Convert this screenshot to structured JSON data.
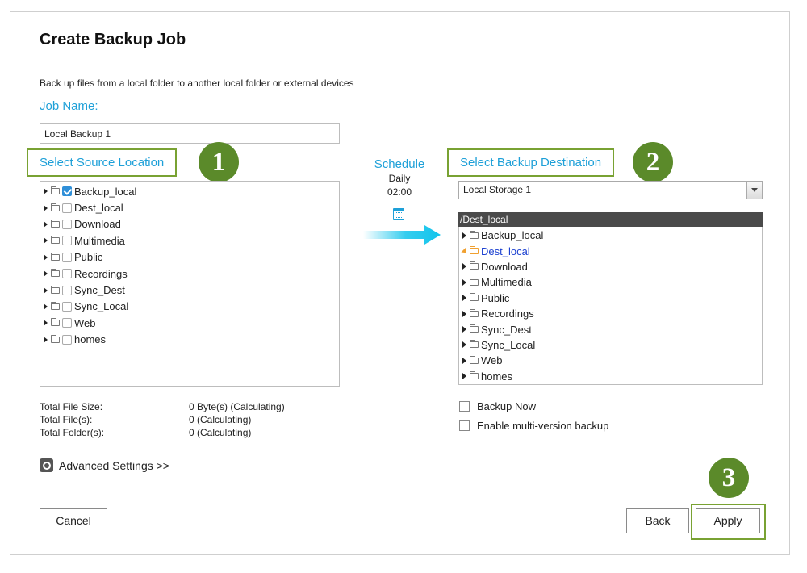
{
  "dialog": {
    "title": "Create Backup Job",
    "description": "Back up files from a local folder to another local folder or external devices",
    "job_name_label": "Job Name:",
    "job_name_value": "Local Backup 1"
  },
  "source": {
    "title": "Select Source Location",
    "step": "1",
    "items": [
      {
        "label": "Backup_local",
        "checked": true
      },
      {
        "label": "Dest_local",
        "checked": false
      },
      {
        "label": "Download",
        "checked": false
      },
      {
        "label": "Multimedia",
        "checked": false
      },
      {
        "label": "Public",
        "checked": false
      },
      {
        "label": "Recordings",
        "checked": false
      },
      {
        "label": "Sync_Dest",
        "checked": false
      },
      {
        "label": "Sync_Local",
        "checked": false
      },
      {
        "label": "Web",
        "checked": false
      },
      {
        "label": "homes",
        "checked": false
      }
    ]
  },
  "schedule": {
    "label": "Schedule",
    "frequency": "Daily",
    "time": "02:00",
    "icon": "calendar-icon"
  },
  "destination": {
    "title": "Select Backup Destination",
    "step": "2",
    "storage_selected": "Local Storage 1",
    "current_path": "/Dest_local",
    "items": [
      {
        "label": "Backup_local",
        "active": false
      },
      {
        "label": "Dest_local",
        "active": true
      },
      {
        "label": "Download",
        "active": false
      },
      {
        "label": "Multimedia",
        "active": false
      },
      {
        "label": "Public",
        "active": false
      },
      {
        "label": "Recordings",
        "active": false
      },
      {
        "label": "Sync_Dest",
        "active": false
      },
      {
        "label": "Sync_Local",
        "active": false
      },
      {
        "label": "Web",
        "active": false
      },
      {
        "label": "homes",
        "active": false
      }
    ],
    "options": [
      {
        "label": "Backup Now",
        "checked": false
      },
      {
        "label": "Enable multi-version backup",
        "checked": false
      }
    ]
  },
  "stats": [
    {
      "key": "Total File Size:",
      "value": "0 Byte(s) (Calculating)"
    },
    {
      "key": "Total File(s):",
      "value": "0 (Calculating)"
    },
    {
      "key": "Total Folder(s):",
      "value": "0 (Calculating)"
    }
  ],
  "advanced_settings_label": "Advanced Settings >>",
  "buttons": {
    "cancel": "Cancel",
    "back": "Back",
    "apply": "Apply",
    "apply_step": "3"
  },
  "colors": {
    "accent_blue": "#1ea0d8",
    "highlight_green": "#79a233",
    "badge_green": "#5b8a2a",
    "active_item": "#1a3fd0",
    "arrow_cyan": "#12c4ec"
  }
}
